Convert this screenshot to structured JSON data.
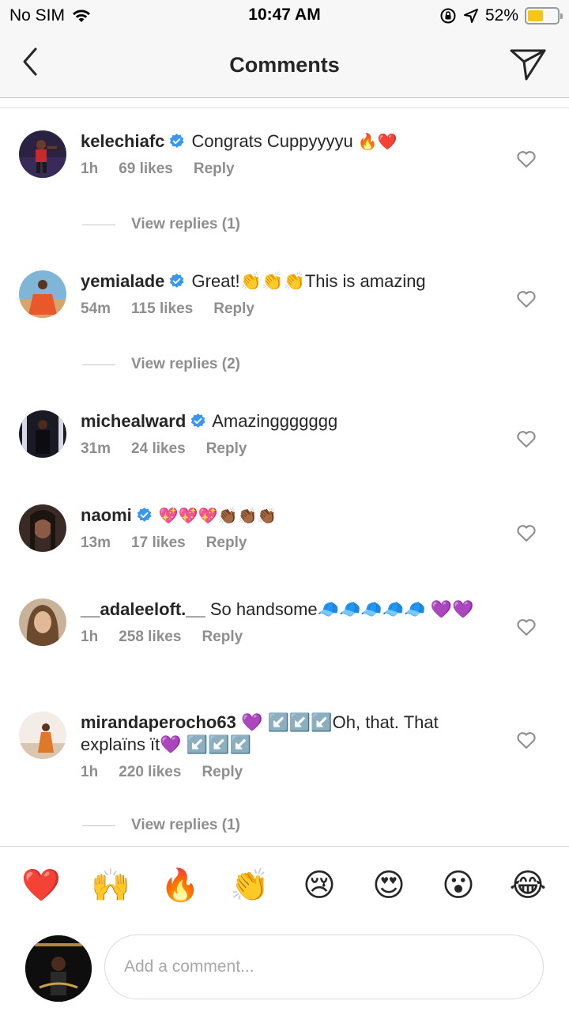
{
  "status_bar": {
    "carrier": "No SIM",
    "time": "10:47 AM",
    "battery_percent": "52%",
    "battery_level": 0.52,
    "battery_color": "#f5c518"
  },
  "header": {
    "title": "Comments",
    "back_icon": "chevron-left-icon",
    "share_icon": "paper-plane-icon"
  },
  "comments": [
    {
      "username": "kelechiafc",
      "verified": true,
      "text": "Congrats Cuppyyyyu",
      "emojis": "🔥❤️",
      "time": "1h",
      "likes": "69 likes",
      "reply_label": "Reply",
      "view_replies": "View replies (1)"
    },
    {
      "username": "yemialade",
      "verified": true,
      "text": "Great!👏👏👏This is amazing",
      "emojis": "",
      "time": "54m",
      "likes": "115 likes",
      "reply_label": "Reply",
      "view_replies": "View replies (2)"
    },
    {
      "username": "michealward",
      "verified": true,
      "text": "Amazinggggggg",
      "emojis": "",
      "time": "31m",
      "likes": "24 likes",
      "reply_label": "Reply",
      "view_replies": ""
    },
    {
      "username": "naomi",
      "verified": true,
      "text": "💖💖💖👏🏾👏🏾👏🏾",
      "emojis": "",
      "time": "13m",
      "likes": "17 likes",
      "reply_label": "Reply",
      "view_replies": ""
    },
    {
      "username": "__adaleeloft.__",
      "verified": false,
      "text": "So handsome🧢🧢🧢🧢🧢 💜💜",
      "emojis": "",
      "time": "1h",
      "likes": "258 likes",
      "reply_label": "Reply",
      "view_replies": ""
    },
    {
      "username": "mirandaperocho63",
      "verified": false,
      "text": "💜 ↙️↙️↙️Oh, that. That explaïns ït💜 ↙️↙️↙️",
      "emojis": "",
      "time": "1h",
      "likes": "220 likes",
      "reply_label": "Reply",
      "view_replies": "View replies (1)"
    }
  ],
  "emoji_bar": [
    "❤️",
    "🙌",
    "🔥",
    "👏",
    "😢",
    "😍",
    "😮",
    "😂"
  ],
  "composer": {
    "placeholder": "Add a comment..."
  },
  "colors": {
    "verified_blue": "#3897f0",
    "meta_gray": "#8e8e8e",
    "header_bg": "#f7f7f7"
  }
}
